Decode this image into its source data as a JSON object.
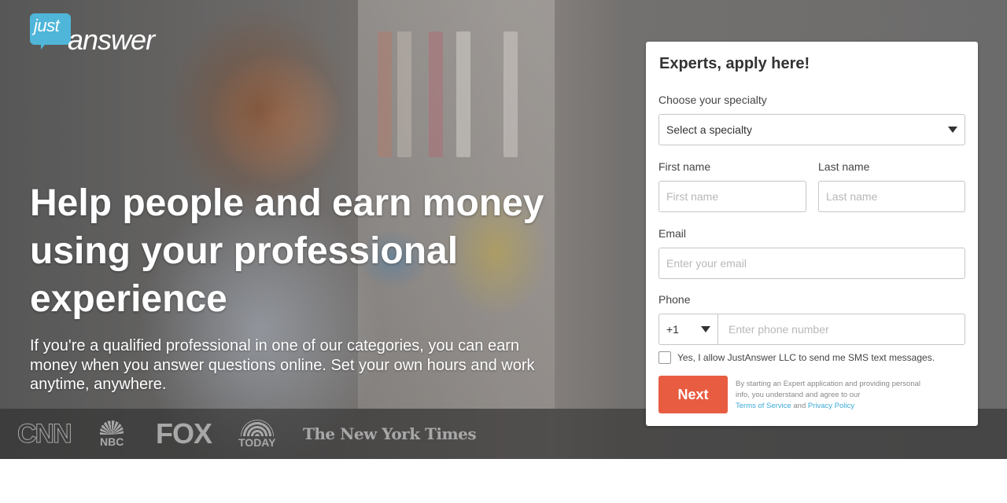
{
  "brand": {
    "logo_top": "just",
    "logo_bottom": "answer",
    "accent_color": "#4fb6d9",
    "cta_color": "#e85c41"
  },
  "hero": {
    "headline": "Help people and earn money using your professional experience",
    "subtext": "If you're a qualified professional in one of our categories, you can earn money when you answer questions online. Set your own hours and work anytime, anywhere."
  },
  "press": {
    "logos": [
      {
        "name": "CNN",
        "icon": "cnn-logo"
      },
      {
        "name": "NBC",
        "icon": "nbc-logo"
      },
      {
        "name": "FOX",
        "icon": "fox-logo"
      },
      {
        "name": "TODAY",
        "icon": "today-logo"
      },
      {
        "name": "The New York Times",
        "icon": "nyt-logo"
      }
    ]
  },
  "form": {
    "title": "Experts, apply here!",
    "specialty": {
      "label": "Choose your specialty",
      "selected": "Select a specialty"
    },
    "first_name": {
      "label": "First name",
      "placeholder": "First name",
      "value": ""
    },
    "last_name": {
      "label": "Last name",
      "placeholder": "Last name",
      "value": ""
    },
    "email": {
      "label": "Email",
      "placeholder": "Enter your email",
      "value": ""
    },
    "phone": {
      "label": "Phone",
      "country_code": "+1",
      "placeholder": "Enter phone number",
      "value": ""
    },
    "sms_consent": {
      "label": "Yes, I allow JustAnswer LLC to send me SMS text messages.",
      "checked": false
    },
    "next_label": "Next",
    "legal": {
      "text": "By starting an Expert application and providing personal info, you understand and agree to our",
      "terms_label": "Terms of Service",
      "and": "and",
      "privacy_label": "Privacy Policy"
    }
  }
}
